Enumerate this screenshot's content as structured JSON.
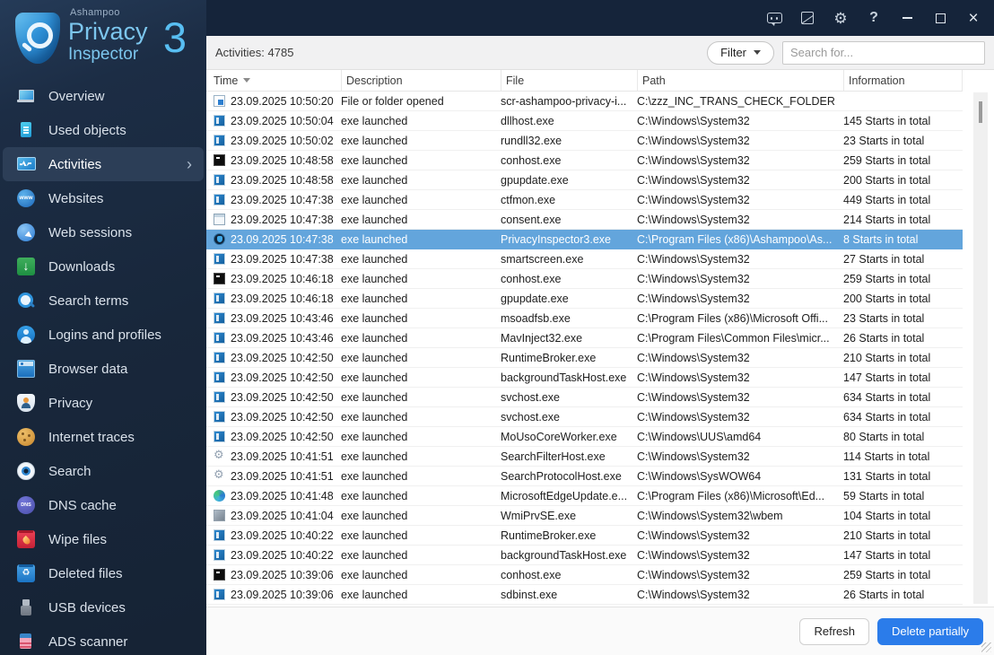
{
  "colors": {
    "accent": "#2b7cea",
    "row_selection": "#63a5dc",
    "sidebar_bg": "#1b2b42",
    "titlebar_bg": "#15243a"
  },
  "logo": {
    "brand": "Ashampoo",
    "line1": "Privacy",
    "line2": "Inspector",
    "version": "3"
  },
  "titlebar": {
    "icons": [
      "feedback-icon",
      "notes-icon",
      "settings-gear-icon",
      "help-icon",
      "minimize-icon",
      "maximize-icon",
      "close-icon"
    ]
  },
  "sidebar": {
    "selected_index": 2,
    "items": [
      {
        "label": "Overview",
        "icon": "overview"
      },
      {
        "label": "Used objects",
        "icon": "used-objects"
      },
      {
        "label": "Activities",
        "icon": "activities"
      },
      {
        "label": "Websites",
        "icon": "websites"
      },
      {
        "label": "Web sessions",
        "icon": "web-sessions"
      },
      {
        "label": "Downloads",
        "icon": "downloads"
      },
      {
        "label": "Search terms",
        "icon": "search-terms"
      },
      {
        "label": "Logins and profiles",
        "icon": "logins-and-profiles"
      },
      {
        "label": "Browser data",
        "icon": "browser-data"
      },
      {
        "label": "Privacy",
        "icon": "privacy"
      },
      {
        "label": "Internet traces",
        "icon": "internet-traces"
      },
      {
        "label": "Search",
        "icon": "search"
      },
      {
        "label": "DNS cache",
        "icon": "dns-cache"
      },
      {
        "label": "Wipe files",
        "icon": "wipe-files"
      },
      {
        "label": "Deleted files",
        "icon": "deleted-files"
      },
      {
        "label": "USB devices",
        "icon": "usb-devices"
      },
      {
        "label": "ADS scanner",
        "icon": "ads-scanner"
      }
    ]
  },
  "toolbar": {
    "count_label": "Activities: 4785",
    "filter_label": "Filter",
    "search_placeholder": "Search for..."
  },
  "table": {
    "columns": [
      {
        "label": "Time",
        "sorted": "desc"
      },
      {
        "label": "Description"
      },
      {
        "label": "File"
      },
      {
        "label": "Path"
      },
      {
        "label": "Information"
      }
    ],
    "selected_index": 7,
    "rows": [
      {
        "icon": "file",
        "time": "23.09.2025 10:50:20",
        "description": "File or folder opened",
        "file": "scr-ashampoo-privacy-i...",
        "path": "C:\\zzz_INC_TRANS_CHECK_FOLDER",
        "info": ""
      },
      {
        "icon": "app",
        "time": "23.09.2025 10:50:04",
        "description": "exe launched",
        "file": "dllhost.exe",
        "path": "C:\\Windows\\System32",
        "info": "145 Starts in total"
      },
      {
        "icon": "app",
        "time": "23.09.2025 10:50:02",
        "description": "exe launched",
        "file": "rundll32.exe",
        "path": "C:\\Windows\\System32",
        "info": "23 Starts in total"
      },
      {
        "icon": "console",
        "time": "23.09.2025 10:48:58",
        "description": "exe launched",
        "file": "conhost.exe",
        "path": "C:\\Windows\\System32",
        "info": "259 Starts in total"
      },
      {
        "icon": "app",
        "time": "23.09.2025 10:48:58",
        "description": "exe launched",
        "file": "gpupdate.exe",
        "path": "C:\\Windows\\System32",
        "info": "200 Starts in total"
      },
      {
        "icon": "app",
        "time": "23.09.2025 10:47:38",
        "description": "exe launched",
        "file": "ctfmon.exe",
        "path": "C:\\Windows\\System32",
        "info": "449 Starts in total"
      },
      {
        "icon": "window",
        "time": "23.09.2025 10:47:38",
        "description": "exe launched",
        "file": "consent.exe",
        "path": "C:\\Windows\\System32",
        "info": "214 Starts in total"
      },
      {
        "icon": "shield",
        "time": "23.09.2025 10:47:38",
        "description": "exe launched",
        "file": "PrivacyInspector3.exe",
        "path": "C:\\Program Files (x86)\\Ashampoo\\As...",
        "info": "8 Starts in total"
      },
      {
        "icon": "app",
        "time": "23.09.2025 10:47:38",
        "description": "exe launched",
        "file": "smartscreen.exe",
        "path": "C:\\Windows\\System32",
        "info": "27 Starts in total"
      },
      {
        "icon": "console",
        "time": "23.09.2025 10:46:18",
        "description": "exe launched",
        "file": "conhost.exe",
        "path": "C:\\Windows\\System32",
        "info": "259 Starts in total"
      },
      {
        "icon": "app",
        "time": "23.09.2025 10:46:18",
        "description": "exe launched",
        "file": "gpupdate.exe",
        "path": "C:\\Windows\\System32",
        "info": "200 Starts in total"
      },
      {
        "icon": "app",
        "time": "23.09.2025 10:43:46",
        "description": "exe launched",
        "file": "msoadfsb.exe",
        "path": "C:\\Program Files (x86)\\Microsoft Offi...",
        "info": "23 Starts in total"
      },
      {
        "icon": "app",
        "time": "23.09.2025 10:43:46",
        "description": "exe launched",
        "file": "MavInject32.exe",
        "path": "C:\\Program Files\\Common Files\\micr...",
        "info": "26 Starts in total"
      },
      {
        "icon": "app",
        "time": "23.09.2025 10:42:50",
        "description": "exe launched",
        "file": "RuntimeBroker.exe",
        "path": "C:\\Windows\\System32",
        "info": "210 Starts in total"
      },
      {
        "icon": "app",
        "time": "23.09.2025 10:42:50",
        "description": "exe launched",
        "file": "backgroundTaskHost.exe",
        "path": "C:\\Windows\\System32",
        "info": "147 Starts in total"
      },
      {
        "icon": "app",
        "time": "23.09.2025 10:42:50",
        "description": "exe launched",
        "file": "svchost.exe",
        "path": "C:\\Windows\\System32",
        "info": "634 Starts in total"
      },
      {
        "icon": "app",
        "time": "23.09.2025 10:42:50",
        "description": "exe launched",
        "file": "svchost.exe",
        "path": "C:\\Windows\\System32",
        "info": "634 Starts in total"
      },
      {
        "icon": "app",
        "time": "23.09.2025 10:42:50",
        "description": "exe launched",
        "file": "MoUsoCoreWorker.exe",
        "path": "C:\\Windows\\UUS\\amd64",
        "info": "80 Starts in total"
      },
      {
        "icon": "gear",
        "time": "23.09.2025 10:41:51",
        "description": "exe launched",
        "file": "SearchFilterHost.exe",
        "path": "C:\\Windows\\System32",
        "info": "114 Starts in total"
      },
      {
        "icon": "gear",
        "time": "23.09.2025 10:41:51",
        "description": "exe launched",
        "file": "SearchProtocolHost.exe",
        "path": "C:\\Windows\\SysWOW64",
        "info": "131 Starts in total"
      },
      {
        "icon": "edge",
        "time": "23.09.2025 10:41:48",
        "description": "exe launched",
        "file": "MicrosoftEdgeUpdate.e...",
        "path": "C:\\Program Files (x86)\\Microsoft\\Ed...",
        "info": "59 Starts in total"
      },
      {
        "icon": "wmi",
        "time": "23.09.2025 10:41:04",
        "description": "exe launched",
        "file": "WmiPrvSE.exe",
        "path": "C:\\Windows\\System32\\wbem",
        "info": "104 Starts in total"
      },
      {
        "icon": "app",
        "time": "23.09.2025 10:40:22",
        "description": "exe launched",
        "file": "RuntimeBroker.exe",
        "path": "C:\\Windows\\System32",
        "info": "210 Starts in total"
      },
      {
        "icon": "app",
        "time": "23.09.2025 10:40:22",
        "description": "exe launched",
        "file": "backgroundTaskHost.exe",
        "path": "C:\\Windows\\System32",
        "info": "147 Starts in total"
      },
      {
        "icon": "console",
        "time": "23.09.2025 10:39:06",
        "description": "exe launched",
        "file": "conhost.exe",
        "path": "C:\\Windows\\System32",
        "info": "259 Starts in total"
      },
      {
        "icon": "app",
        "time": "23.09.2025 10:39:06",
        "description": "exe launched",
        "file": "sdbinst.exe",
        "path": "C:\\Windows\\System32",
        "info": "26 Starts in total"
      }
    ]
  },
  "footer": {
    "refresh_label": "Refresh",
    "delete_label": "Delete partially"
  }
}
